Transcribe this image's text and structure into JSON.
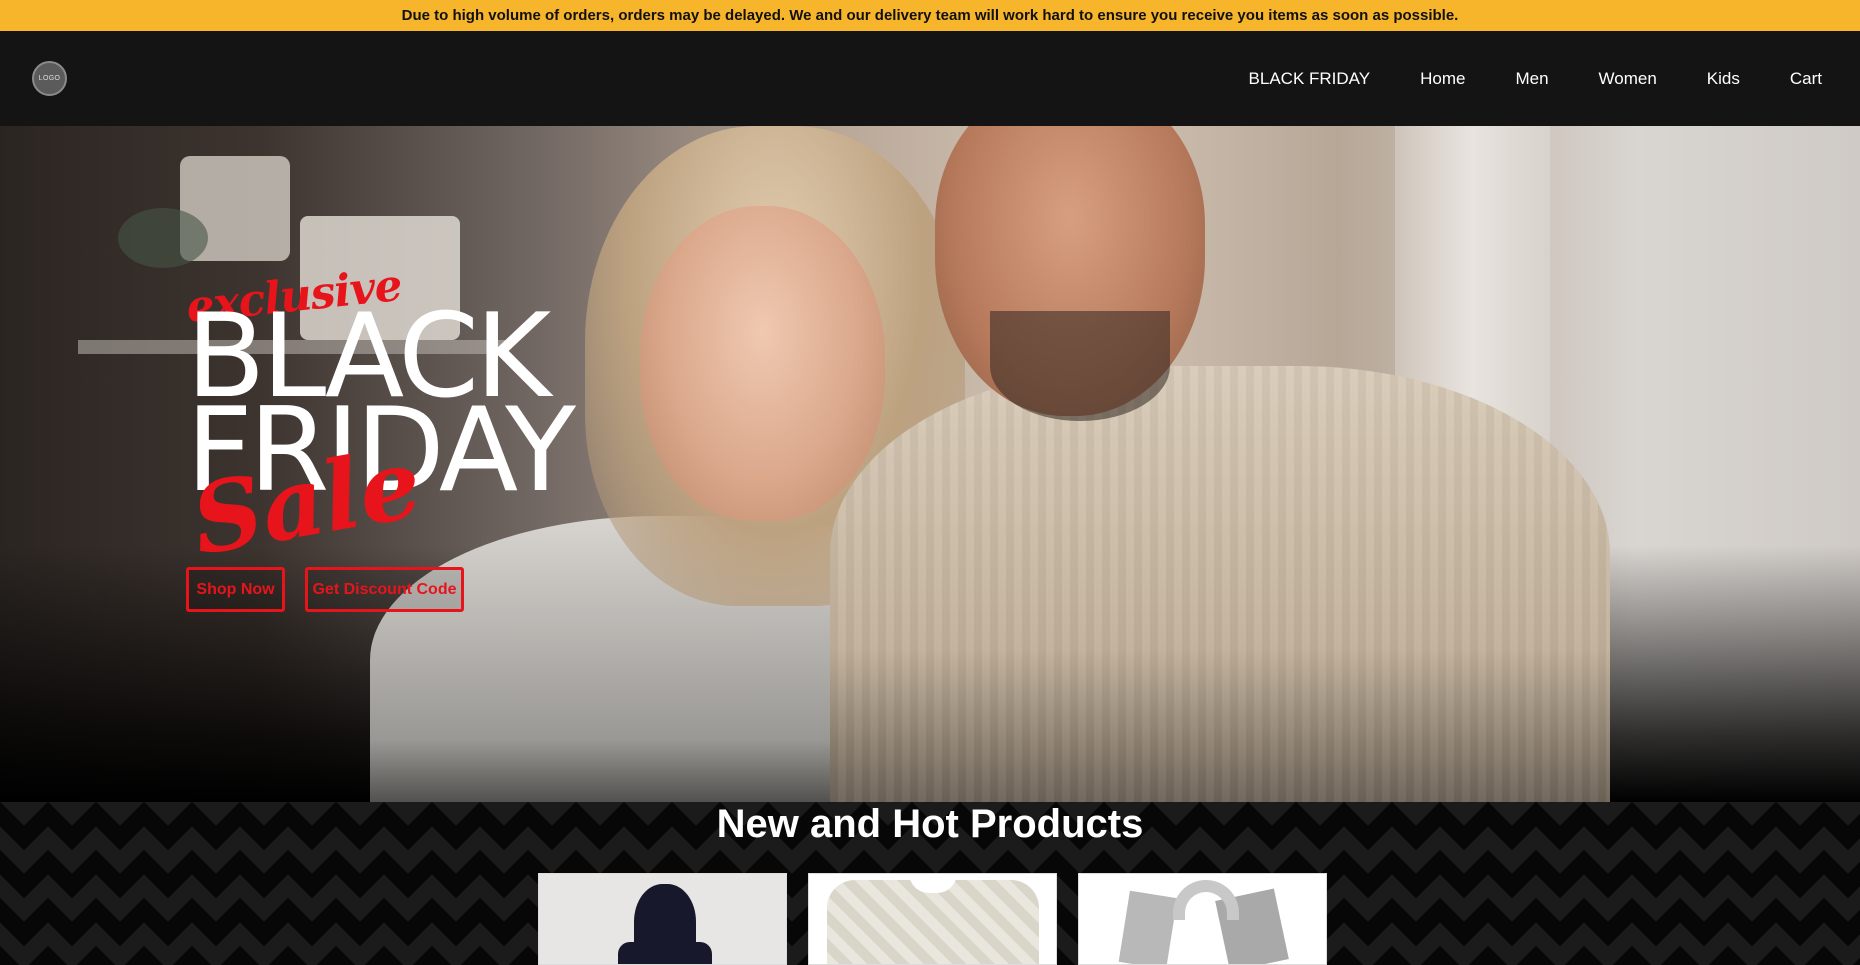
{
  "announcement": {
    "text": "Due to high volume of orders, orders may be delayed. We and our delivery team will work hard to ensure you receive you items as soon as possible."
  },
  "header": {
    "logo_text": "LOGO",
    "nav": [
      "BLACK FRIDAY",
      "Home",
      "Men",
      "Women",
      "Kids",
      "Cart"
    ]
  },
  "hero": {
    "tagline": "exclusive",
    "headline_line1": "BLACK",
    "headline_line2": "FRIDAY",
    "script_word": "Sale",
    "buttons": {
      "shop_now": "Shop Now",
      "discount": "Get Discount Code"
    }
  },
  "products": {
    "title": "New and Hot Products",
    "items": [
      {
        "icon": "hoodie-image"
      },
      {
        "icon": "knit-sweater-image"
      },
      {
        "icon": "scarf-image"
      }
    ]
  },
  "colors": {
    "announcement_bg": "#f7b52c",
    "nav_bg": "#141414",
    "accent_red": "#e8141b"
  }
}
